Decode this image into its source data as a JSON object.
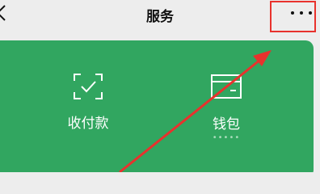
{
  "navbar": {
    "title": "服务",
    "back_icon": "chevron-left-icon",
    "more_icon": "more-horizontal-icon"
  },
  "services": [
    {
      "label": "收付款",
      "icon": "scan-check-icon"
    },
    {
      "label": "钱包",
      "icon": "wallet-icon",
      "balance": "•••••"
    }
  ],
  "annotation": {
    "highlight_color": "#e8322d",
    "arrow_color": "#e8322d"
  },
  "colors": {
    "background": "#ededed",
    "card": "#31a660",
    "text": "#111111"
  }
}
